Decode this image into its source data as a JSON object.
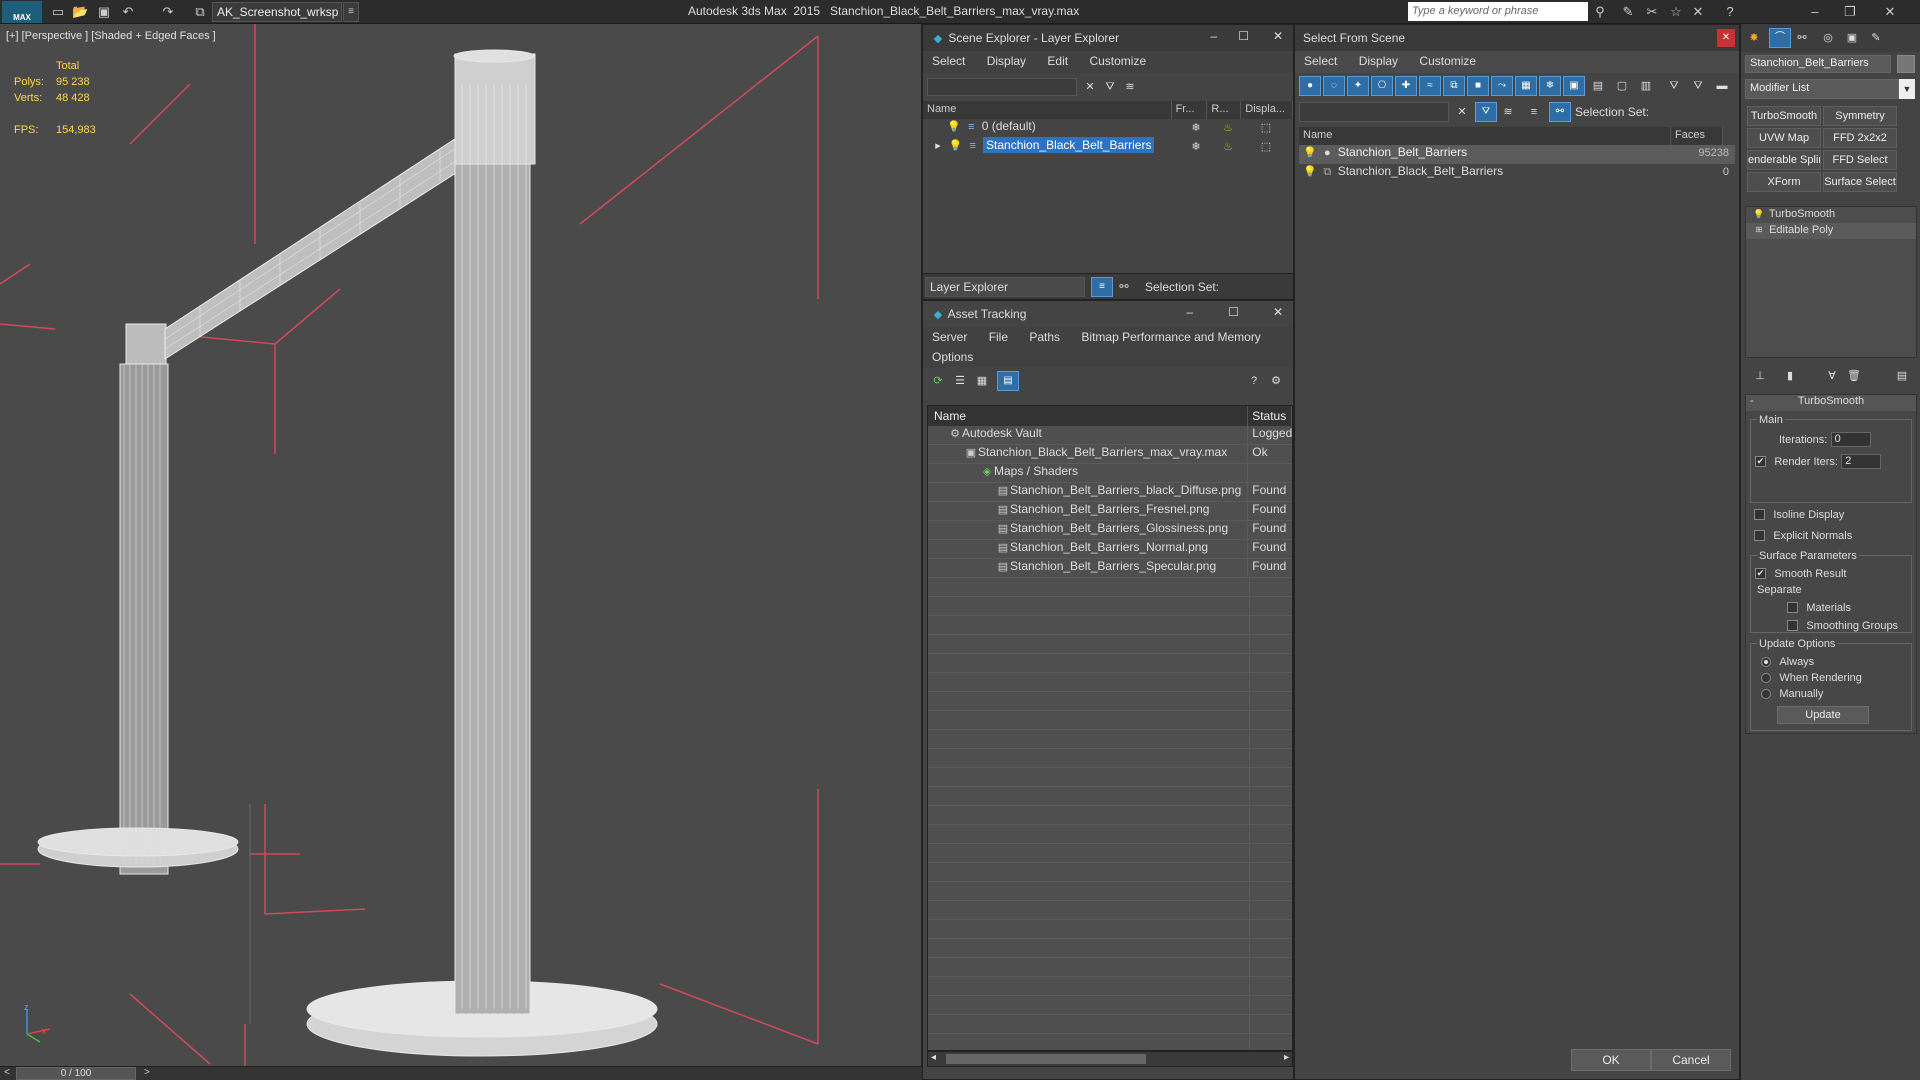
{
  "titlebar": {
    "logo": "MAX",
    "workspace": "AK_Screenshot_wrksp",
    "app_title": "Autodesk 3ds Max  2015",
    "file_title": "Stanchion_Black_Belt_Barriers_max_vray.max",
    "search_placeholder": "Type a keyword or phrase"
  },
  "viewport": {
    "label": "[+] [Perspective ] [Shaded + Edged Faces ]",
    "stats_total": "Total",
    "polys_label": "Polys:",
    "polys_value": "95 238",
    "verts_label": "Verts:",
    "verts_value": "48 428",
    "fps_label": "FPS:",
    "fps_value": "154,983",
    "axis_z": "z",
    "axis_x": "x"
  },
  "timebar": {
    "value": "0 / 100",
    "prev": "<",
    "next": ">"
  },
  "scene_explorer": {
    "title": "Scene Explorer - Layer Explorer",
    "menu": [
      "Select",
      "Display",
      "Edit",
      "Customize"
    ],
    "columns": [
      "Name",
      "Fr...",
      "R...",
      "Displa..."
    ],
    "rows": [
      "0 (default)",
      "Stanchion_Black_Belt_Barriers"
    ],
    "footer_mode": "Layer Explorer",
    "selection_set": "Selection Set:"
  },
  "asset_tracking": {
    "title": "Asset Tracking",
    "menu": [
      "Server",
      "File",
      "Paths",
      "Bitmap Performance and Memory"
    ],
    "menu2": "Options",
    "columns": [
      "Name",
      "Status"
    ],
    "rows": [
      {
        "name": "Autodesk Vault",
        "status": "Logged"
      },
      {
        "name": "Stanchion_Black_Belt_Barriers_max_vray.max",
        "status": "Ok"
      },
      {
        "name": "Maps / Shaders",
        "status": ""
      },
      {
        "name": "Stanchion_Belt_Barriers_black_Diffuse.png",
        "status": "Found"
      },
      {
        "name": "Stanchion_Belt_Barriers_Fresnel.png",
        "status": "Found"
      },
      {
        "name": "Stanchion_Belt_Barriers_Glossiness.png",
        "status": "Found"
      },
      {
        "name": "Stanchion_Belt_Barriers_Normal.png",
        "status": "Found"
      },
      {
        "name": "Stanchion_Belt_Barriers_Specular.png",
        "status": "Found"
      }
    ]
  },
  "select_from_scene": {
    "title": "Select From Scene",
    "menu": [
      "Select",
      "Display",
      "Customize"
    ],
    "selection_set": "Selection Set:",
    "columns": [
      "Name",
      "Faces"
    ],
    "rows": [
      {
        "name": "Stanchion_Belt_Barriers",
        "faces": "95238"
      },
      {
        "name": "Stanchion_Black_Belt_Barriers",
        "faces": "0"
      }
    ],
    "ok": "OK",
    "cancel": "Cancel"
  },
  "command_panel": {
    "object_name": "Stanchion_Belt_Barriers",
    "modifier_list": "Modifier List",
    "mod_buttons": [
      "TurboSmooth",
      "Symmetry",
      "UVW Map",
      "FFD 2x2x2",
      "enderable Splir",
      "FFD Select",
      "XForm",
      "Surface Select"
    ],
    "stack": [
      "TurboSmooth",
      "Editable Poly"
    ],
    "rollout_title": "TurboSmooth",
    "main_label": "Main",
    "iterations_label": "Iterations:",
    "iterations_value": "0",
    "render_iters_label": "Render Iters:",
    "render_iters_value": "2",
    "isoline": "Isoline Display",
    "explicit_normals": "Explicit Normals",
    "surface_params": "Surface Parameters",
    "smooth_result": "Smooth Result",
    "separate": "Separate",
    "materials": "Materials",
    "smoothing_groups": "Smoothing Groups",
    "update_options": "Update Options",
    "always": "Always",
    "when_rendering": "When Rendering",
    "manually": "Manually",
    "update_btn": "Update"
  }
}
